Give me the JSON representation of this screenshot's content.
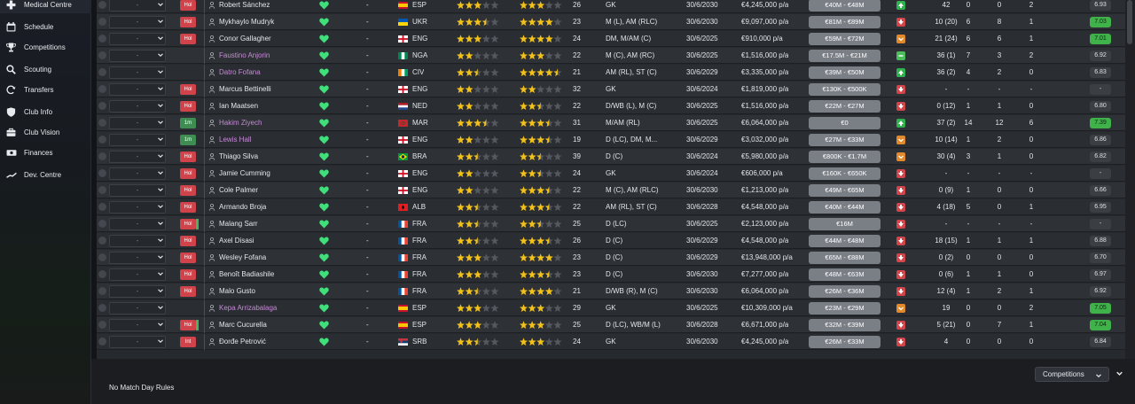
{
  "sidebar": {
    "items": [
      {
        "label": "Medical Centre",
        "icon": "medical-cross-icon",
        "active": true
      },
      {
        "label": "Schedule",
        "icon": "calendar-icon"
      },
      {
        "label": "Competitions",
        "icon": "trophy-icon"
      },
      {
        "label": "Scouting",
        "icon": "magnifier-icon"
      },
      {
        "label": "Transfers",
        "icon": "transfer-arrows-icon"
      },
      {
        "label": "Club Info",
        "icon": "shield-icon"
      },
      {
        "label": "Club Vision",
        "icon": "briefcase-icon"
      },
      {
        "label": "Finances",
        "icon": "banknote-icon"
      },
      {
        "label": "Dev. Centre",
        "icon": "trend-line-icon"
      }
    ]
  },
  "selection_placeholder": "-",
  "players": [
    {
      "status": "Hol",
      "name": "Robert Sánchez",
      "loaned": false,
      "dash": "-",
      "nat": "ESP",
      "flag": "esp",
      "ca": 3,
      "pa": 3,
      "age": "26",
      "pos": "GK",
      "expires": "30/6/2030",
      "wage": "€4,245,000 p/a",
      "value": "€40M - €48M",
      "morale": "good",
      "apps": "42",
      "gls": "0",
      "ast": "0",
      "pom": "2",
      "rating": "6.93",
      "rating_green": false
    },
    {
      "status": "Hol",
      "name": "Mykhaylo Mudryk",
      "loaned": false,
      "dash": "-",
      "nat": "UKR",
      "flag": "ukr",
      "ca": 3.5,
      "pa": 4,
      "age": "23",
      "pos": "M (L), AM (RLC)",
      "expires": "30/6/2030",
      "wage": "€9,097,000 p/a",
      "value": "€81M - €89M",
      "morale": "poor",
      "apps": "10 (20)",
      "gls": "6",
      "ast": "8",
      "pom": "1",
      "rating": "7.03",
      "rating_green": true
    },
    {
      "status": "Hol",
      "name": "Conor Gallagher",
      "loaned": false,
      "dash": "-",
      "nat": "ENG",
      "flag": "eng",
      "ca": 3,
      "pa": 4,
      "age": "24",
      "pos": "DM, M/AM (C)",
      "expires": "30/6/2025",
      "wage": "€910,000 p/a",
      "value": "€59M - €72M",
      "morale": "unhappy",
      "apps": "21 (24)",
      "gls": "6",
      "ast": "6",
      "pom": "1",
      "rating": "7.01",
      "rating_green": true
    },
    {
      "status": "",
      "name": "Faustino Anjorin",
      "loaned": true,
      "dash": "-",
      "nat": "NGA",
      "flag": "nga",
      "ca": 2,
      "pa": 3,
      "age": "22",
      "pos": "M (C), AM (RC)",
      "expires": "30/6/2025",
      "wage": "€1,516,000 p/a",
      "value": "€17.5M - €21M",
      "morale": "okay",
      "apps": "36 (1)",
      "gls": "7",
      "ast": "3",
      "pom": "2",
      "rating": "6.92",
      "rating_green": false
    },
    {
      "status": "",
      "name": "Datro Fofana",
      "loaned": true,
      "dash": "-",
      "nat": "CIV",
      "flag": "civ",
      "ca": 2.5,
      "pa": 4.5,
      "age": "21",
      "pos": "AM (RL), ST (C)",
      "expires": "30/6/2029",
      "wage": "€3,335,000 p/a",
      "value": "€39M - €50M",
      "morale": "good",
      "apps": "36 (2)",
      "gls": "4",
      "ast": "2",
      "pom": "0",
      "rating": "6.83",
      "rating_green": false
    },
    {
      "status": "Hol",
      "name": "Marcus Bettinelli",
      "loaned": false,
      "dash": "-",
      "nat": "ENG",
      "flag": "eng",
      "ca": 2,
      "pa": 2,
      "age": "32",
      "pos": "GK",
      "expires": "30/6/2024",
      "wage": "€1,819,000 p/a",
      "value": "€130K - €500K",
      "morale": "poor",
      "apps": "-",
      "gls": "-",
      "ast": "-",
      "pom": "-",
      "rating": "-",
      "rating_green": false
    },
    {
      "status": "Hol",
      "name": "Ian Maatsen",
      "loaned": false,
      "dash": "-",
      "nat": "NED",
      "flag": "ned",
      "ca": 2,
      "pa": 2.5,
      "age": "22",
      "pos": "D/WB (L), M (C)",
      "expires": "30/6/2025",
      "wage": "€1,516,000 p/a",
      "value": "€22M - €27M",
      "morale": "poor",
      "apps": "0 (12)",
      "gls": "1",
      "ast": "1",
      "pom": "0",
      "rating": "6.80",
      "rating_green": false
    },
    {
      "status": "1m",
      "name": "Hakim Ziyech",
      "loaned": true,
      "dash": "-",
      "nat": "MAR",
      "flag": "mar",
      "ca": 3.5,
      "pa": 3.5,
      "age": "31",
      "pos": "M/AM (RL)",
      "expires": "30/6/2025",
      "wage": "€6,064,000 p/a",
      "value": "€0",
      "morale": "good",
      "apps": "37 (2)",
      "gls": "14",
      "ast": "12",
      "pom": "6",
      "rating": "7.39",
      "rating_green": true
    },
    {
      "status": "1m",
      "name": "Lewis Hall",
      "loaned": true,
      "dash": "-",
      "nat": "ENG",
      "flag": "eng",
      "ca": 2,
      "pa": 3.5,
      "age": "19",
      "pos": "D (LC), DM, M...",
      "expires": "30/6/2029",
      "wage": "€3,032,000 p/a",
      "value": "€27M - €33M",
      "morale": "unhappy",
      "apps": "10 (14)",
      "gls": "1",
      "ast": "2",
      "pom": "0",
      "rating": "6.86",
      "rating_green": false
    },
    {
      "status": "Hol",
      "name": "Thiago Silva",
      "loaned": false,
      "dash": "-",
      "nat": "BRA",
      "flag": "bra",
      "ca": 2.5,
      "pa": 2.5,
      "age": "39",
      "pos": "D (C)",
      "expires": "30/6/2024",
      "wage": "€5,980,000 p/a",
      "value": "€800K - €1.7M",
      "morale": "unhappy",
      "apps": "30 (4)",
      "gls": "3",
      "ast": "1",
      "pom": "0",
      "rating": "6.82",
      "rating_green": false
    },
    {
      "status": "Hol",
      "name": "Jamie Cumming",
      "loaned": false,
      "dash": "-",
      "nat": "ENG",
      "flag": "eng",
      "ca": 2,
      "pa": 2.5,
      "age": "24",
      "pos": "GK",
      "expires": "30/6/2024",
      "wage": "€606,000 p/a",
      "value": "€160K - €650K",
      "morale": "poor",
      "apps": "-",
      "gls": "-",
      "ast": "-",
      "pom": "-",
      "rating": "-",
      "rating_green": false
    },
    {
      "status": "Hol",
      "name": "Cole Palmer",
      "loaned": false,
      "dash": "-",
      "nat": "ENG",
      "flag": "eng",
      "ca": 2,
      "pa": 3.5,
      "age": "22",
      "pos": "M (C), AM (RLC)",
      "expires": "30/6/2030",
      "wage": "€1,213,000 p/a",
      "value": "€49M - €65M",
      "morale": "poor",
      "apps": "0 (9)",
      "gls": "1",
      "ast": "0",
      "pom": "0",
      "rating": "6.66",
      "rating_green": false
    },
    {
      "status": "Hol",
      "name": "Armando Broja",
      "loaned": false,
      "dash": "-",
      "nat": "ALB",
      "flag": "alb",
      "ca": 2.5,
      "pa": 3.5,
      "age": "22",
      "pos": "AM (RL), ST (C)",
      "expires": "30/6/2028",
      "wage": "€4,548,000 p/a",
      "value": "€40M - €44M",
      "morale": "poor",
      "apps": "4 (18)",
      "gls": "5",
      "ast": "0",
      "pom": "1",
      "rating": "6.95",
      "rating_green": false
    },
    {
      "status": "Hol",
      "name": "Malang Sarr",
      "loaned": false,
      "dash": "-",
      "nat": "FRA",
      "flag": "fra",
      "ca": 2.5,
      "pa": 2.5,
      "age": "25",
      "pos": "D (LC)",
      "expires": "30/6/2025",
      "wage": "€2,123,000 p/a",
      "value": "€16M",
      "morale": "poor",
      "apps": "-",
      "gls": "-",
      "ast": "-",
      "pom": "-",
      "rating": "-",
      "rating_green": false
    },
    {
      "status": "Hol",
      "name": "Axel Disasi",
      "loaned": false,
      "dash": "-",
      "nat": "FRA",
      "flag": "fra",
      "ca": 2.5,
      "pa": 3.5,
      "age": "26",
      "pos": "D (C)",
      "expires": "30/6/2029",
      "wage": "€4,548,000 p/a",
      "value": "€44M - €48M",
      "morale": "poor",
      "apps": "18 (15)",
      "gls": "1",
      "ast": "1",
      "pom": "1",
      "rating": "6.88",
      "rating_green": false
    },
    {
      "status": "Hol",
      "name": "Wesley Fofana",
      "loaned": false,
      "dash": "-",
      "nat": "FRA",
      "flag": "fra",
      "ca": 3,
      "pa": 4,
      "age": "23",
      "pos": "D (C)",
      "expires": "30/6/2029",
      "wage": "€13,948,000 p/a",
      "value": "€65M - €88M",
      "morale": "poor",
      "apps": "0 (2)",
      "gls": "0",
      "ast": "0",
      "pom": "0",
      "rating": "6.70",
      "rating_green": false
    },
    {
      "status": "Hol",
      "name": "Benoît Badiashile",
      "loaned": false,
      "dash": "-",
      "nat": "FRA",
      "flag": "fra",
      "ca": 3,
      "pa": 3.5,
      "age": "23",
      "pos": "D (C)",
      "expires": "30/6/2030",
      "wage": "€7,277,000 p/a",
      "value": "€48M - €63M",
      "morale": "poor",
      "apps": "0 (6)",
      "gls": "1",
      "ast": "1",
      "pom": "0",
      "rating": "6.97",
      "rating_green": false
    },
    {
      "status": "Hol",
      "name": "Malo Gusto",
      "loaned": false,
      "dash": "-",
      "nat": "FRA",
      "flag": "fra",
      "ca": 2.5,
      "pa": 4,
      "age": "21",
      "pos": "D/WB (R), M (C)",
      "expires": "30/6/2030",
      "wage": "€6,064,000 p/a",
      "value": "€26M - €36M",
      "morale": "poor",
      "apps": "12 (4)",
      "gls": "1",
      "ast": "2",
      "pom": "1",
      "rating": "6.92",
      "rating_green": false
    },
    {
      "status": "",
      "name": "Kepa Arrizabalaga",
      "loaned": true,
      "dash": "-",
      "nat": "ESP",
      "flag": "esp",
      "ca": 3,
      "pa": 3,
      "age": "29",
      "pos": "GK",
      "expires": "30/6/2025",
      "wage": "€10,309,000 p/a",
      "value": "€23M - €29M",
      "morale": "unhappy",
      "apps": "19",
      "gls": "0",
      "ast": "0",
      "pom": "2",
      "rating": "7.05",
      "rating_green": true
    },
    {
      "status": "Hol",
      "name": "Marc Cucurella",
      "loaned": false,
      "dash": "-",
      "nat": "ESP",
      "flag": "esp",
      "ca": 3,
      "pa": 3,
      "age": "25",
      "pos": "D (LC), WB/M (L)",
      "expires": "30/6/2028",
      "wage": "€6,671,000 p/a",
      "value": "€32M - €39M",
      "morale": "poor",
      "apps": "5 (21)",
      "gls": "0",
      "ast": "7",
      "pom": "1",
      "rating": "7.04",
      "rating_green": true
    },
    {
      "status": "Int",
      "name": "Đorđe Petrović",
      "loaned": false,
      "dash": "-",
      "nat": "SRB",
      "flag": "srb",
      "ca": 2.5,
      "pa": 3,
      "age": "24",
      "pos": "GK",
      "expires": "30/6/2030",
      "wage": "€4,245,000 p/a",
      "value": "€26M - €33M",
      "morale": "poor",
      "apps": "4",
      "gls": "0",
      "ast": "0",
      "pom": "0",
      "rating": "6.84",
      "rating_green": false
    }
  ],
  "footer": {
    "rules_text": "No Match Day Rules",
    "competitions_label": "Competitions"
  },
  "colors": {
    "heart": "#3fe07a",
    "star": "#f2c21b",
    "loan_name": "#c58bd6",
    "morale_good": "#2fb14e",
    "morale_poor": "#d2454b",
    "morale_unhappy": "#e28a2b",
    "morale_okay": "#4bbd5a",
    "rating_green": "#3fb34a"
  }
}
